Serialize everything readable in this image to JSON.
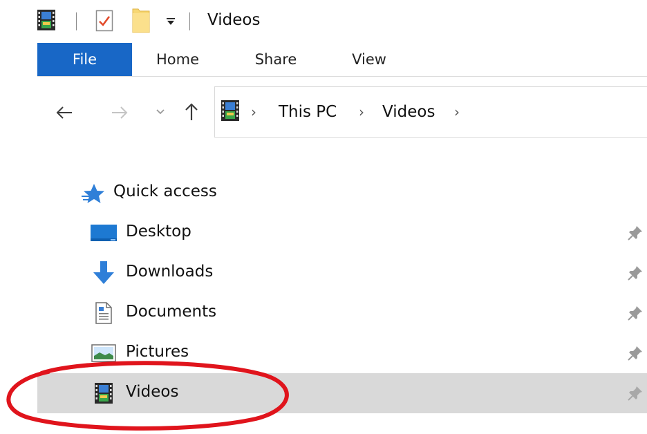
{
  "window": {
    "title": "Videos",
    "quick_access_toolbar": [
      "videos-library-icon",
      "properties-icon",
      "new-folder-icon",
      "customize-dropdown-icon"
    ]
  },
  "ribbon": {
    "tabs": [
      {
        "label": "File",
        "active": true
      },
      {
        "label": "Home"
      },
      {
        "label": "Share"
      },
      {
        "label": "View"
      }
    ]
  },
  "navigation": {
    "back_icon": "arrow-left-icon",
    "forward_icon": "arrow-right-icon",
    "recent_icon": "chevron-down-icon",
    "up_icon": "arrow-up-icon"
  },
  "address_bar": {
    "root_icon": "videos-library-icon",
    "crumbs": [
      "This PC",
      "Videos"
    ],
    "separator": "›"
  },
  "nav_pane": {
    "quick_access_label": "Quick access",
    "quick_access_icon": "star-icon",
    "items": [
      {
        "label": "Desktop",
        "icon": "desktop-icon",
        "pinned": true,
        "selected": false
      },
      {
        "label": "Downloads",
        "icon": "download-arrow-icon",
        "pinned": true,
        "selected": false
      },
      {
        "label": "Documents",
        "icon": "document-icon",
        "pinned": true,
        "selected": false
      },
      {
        "label": "Pictures",
        "icon": "picture-icon",
        "pinned": true,
        "selected": false
      },
      {
        "label": "Videos",
        "icon": "videos-library-icon",
        "pinned": true,
        "selected": true
      }
    ]
  },
  "colors": {
    "file_tab": "#1867c6",
    "selection": "#d9d9d9",
    "annotation": "#e0141c",
    "folder": "#f7d774",
    "download_arrow": "#2f7fd8"
  }
}
